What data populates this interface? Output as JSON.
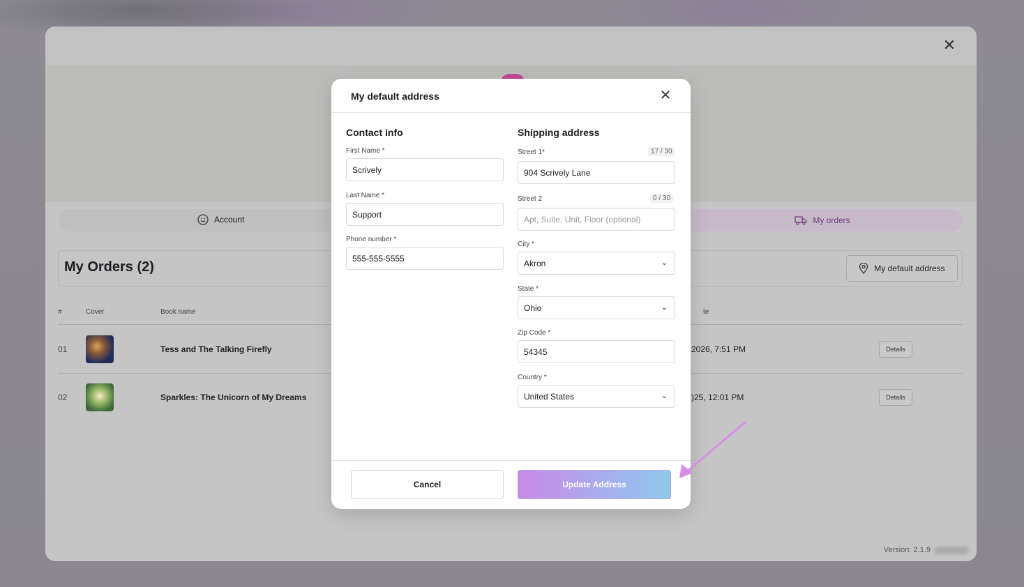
{
  "app": {
    "tabs": {
      "account": "Account",
      "orders": "My orders"
    },
    "orders_title": "My Orders (2)",
    "default_address_button": "My default address",
    "table": {
      "headers": [
        "#",
        "Cover",
        "Book name",
        "te"
      ],
      "rows": [
        {
          "num": "01",
          "name": "Tess and The Talking Firefly",
          "date": "2026, 7:51 PM",
          "action": "Details"
        },
        {
          "num": "02",
          "name": "Sparkles: The Unicorn of My Dreams",
          "date": ")25, 12:01 PM",
          "action": "Details"
        }
      ]
    },
    "version": "Version: 2.1.9"
  },
  "modal": {
    "title": "My default address",
    "contact": {
      "title": "Contact info",
      "first_name_label": "First Name *",
      "first_name": "Scrively",
      "last_name_label": "Last Name *",
      "last_name": "Support",
      "phone_label": "Phone number *",
      "phone": "555-555-5555"
    },
    "shipping": {
      "title": "Shipping address",
      "street1_label": "Street 1*",
      "street1_counter": "17 / 30",
      "street1": "904 Scrively Lane",
      "street2_label": "Street 2",
      "street2_counter": "0 / 30",
      "street2_placeholder": "Apt, Suite, Unit, Floor (optional)",
      "city_label": "City *",
      "city": "Akron",
      "state_label": "State *",
      "state": "Ohio",
      "zip_label": "Zip Code *",
      "zip": "54345",
      "country_label": "Country *",
      "country": "United States"
    },
    "cancel_label": "Cancel",
    "update_label": "Update Address"
  },
  "icons": {
    "close": "close-icon",
    "account": "smile-icon",
    "orders": "truck-icon",
    "location": "map-pin-icon",
    "chevron": "chevron-down-icon"
  }
}
